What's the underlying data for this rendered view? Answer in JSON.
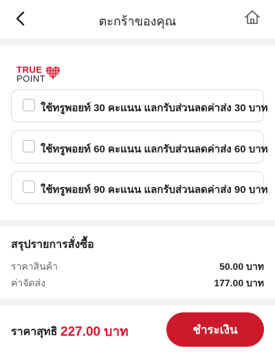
{
  "header": {
    "title": "ตะกร้าของคุณ",
    "back_icon": "chevron-left-icon",
    "home_icon": "home-icon"
  },
  "truepoint": {
    "logo_top": "TRUE",
    "logo_bottom": "POINT",
    "options": [
      {
        "label": "ใช้ทรูพอยท์ 30 คะแนน แลกรับส่วนลดค่าส่ง 30 บาท",
        "checked": false
      },
      {
        "label": "ใช้ทรูพอยท์ 60 คะแนน แลกรับส่วนลดค่าส่ง 60 บาท",
        "checked": false
      },
      {
        "label": "ใช้ทรูพอยท์ 90 คะแนน แลกรับส่วนลดค่าส่ง 90 บาท",
        "checked": false
      }
    ]
  },
  "summary": {
    "title": "สรุปรายการสั่งซื้อ",
    "rows": [
      {
        "label": "ราคาสินค้า",
        "value": "50.00 บาท"
      },
      {
        "label": "ค่าจัดส่ง",
        "value": "177.00 บาท"
      }
    ]
  },
  "footer": {
    "total_label": "ราคาสุทธิ",
    "total_value": "227.00 บาท",
    "pay_label": "ชำระเงิน"
  },
  "colors": {
    "accent": "#e2112c",
    "button": "#cc1a2a",
    "divider": "#f3f3f3"
  }
}
